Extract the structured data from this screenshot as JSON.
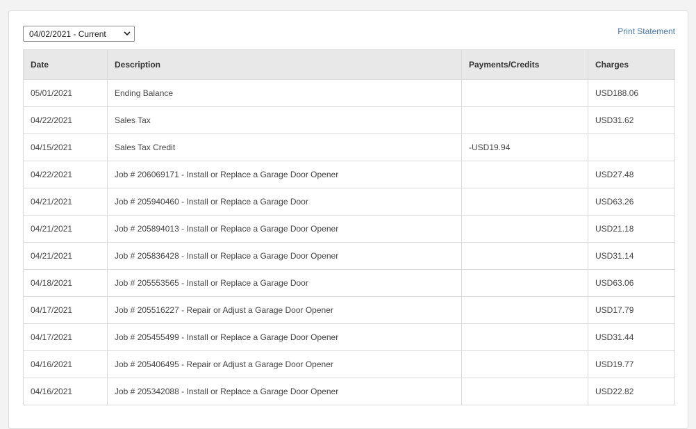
{
  "statement": {
    "period_selected": "04/02/2021 - Current",
    "print_label": "Print Statement"
  },
  "table": {
    "headers": [
      "Date",
      "Description",
      "Payments/Credits",
      "Charges"
    ],
    "rows": [
      {
        "date": "05/01/2021",
        "description": "Ending Balance",
        "payment": "",
        "charge": "USD188.06"
      },
      {
        "date": "04/22/2021",
        "description": "Sales Tax",
        "payment": "",
        "charge": "USD31.62"
      },
      {
        "date": "04/15/2021",
        "description": "Sales Tax Credit",
        "payment": "-USD19.94",
        "charge": ""
      },
      {
        "date": "04/22/2021",
        "description": "Job # 206069171 - Install or Replace a Garage Door Opener",
        "payment": "",
        "charge": "USD27.48"
      },
      {
        "date": "04/21/2021",
        "description": "Job # 205940460 - Install or Replace a Garage Door",
        "payment": "",
        "charge": "USD63.26"
      },
      {
        "date": "04/21/2021",
        "description": "Job # 205894013 - Install or Replace a Garage Door Opener",
        "payment": "",
        "charge": "USD21.18"
      },
      {
        "date": "04/21/2021",
        "description": "Job # 205836428 - Install or Replace a Garage Door Opener",
        "payment": "",
        "charge": "USD31.14"
      },
      {
        "date": "04/18/2021",
        "description": "Job # 205553565 - Install or Replace a Garage Door",
        "payment": "",
        "charge": "USD63.06"
      },
      {
        "date": "04/17/2021",
        "description": "Job # 205516227 - Repair or Adjust a Garage Door Opener",
        "payment": "",
        "charge": "USD17.79"
      },
      {
        "date": "04/17/2021",
        "description": "Job # 205455499 - Install or Replace a Garage Door Opener",
        "payment": "",
        "charge": "USD31.44"
      },
      {
        "date": "04/16/2021",
        "description": "Job # 205406495 - Repair or Adjust a Garage Door Opener",
        "payment": "",
        "charge": "USD19.77"
      },
      {
        "date": "04/16/2021",
        "description": "Job # 205342088 - Install or Replace a Garage Door Opener",
        "payment": "",
        "charge": "USD22.82"
      }
    ]
  },
  "colors": {
    "link": "#4a78a8",
    "header_bg": "#e8e8e8"
  },
  "icons": {
    "select_chevron": "chevron-down-icon"
  }
}
